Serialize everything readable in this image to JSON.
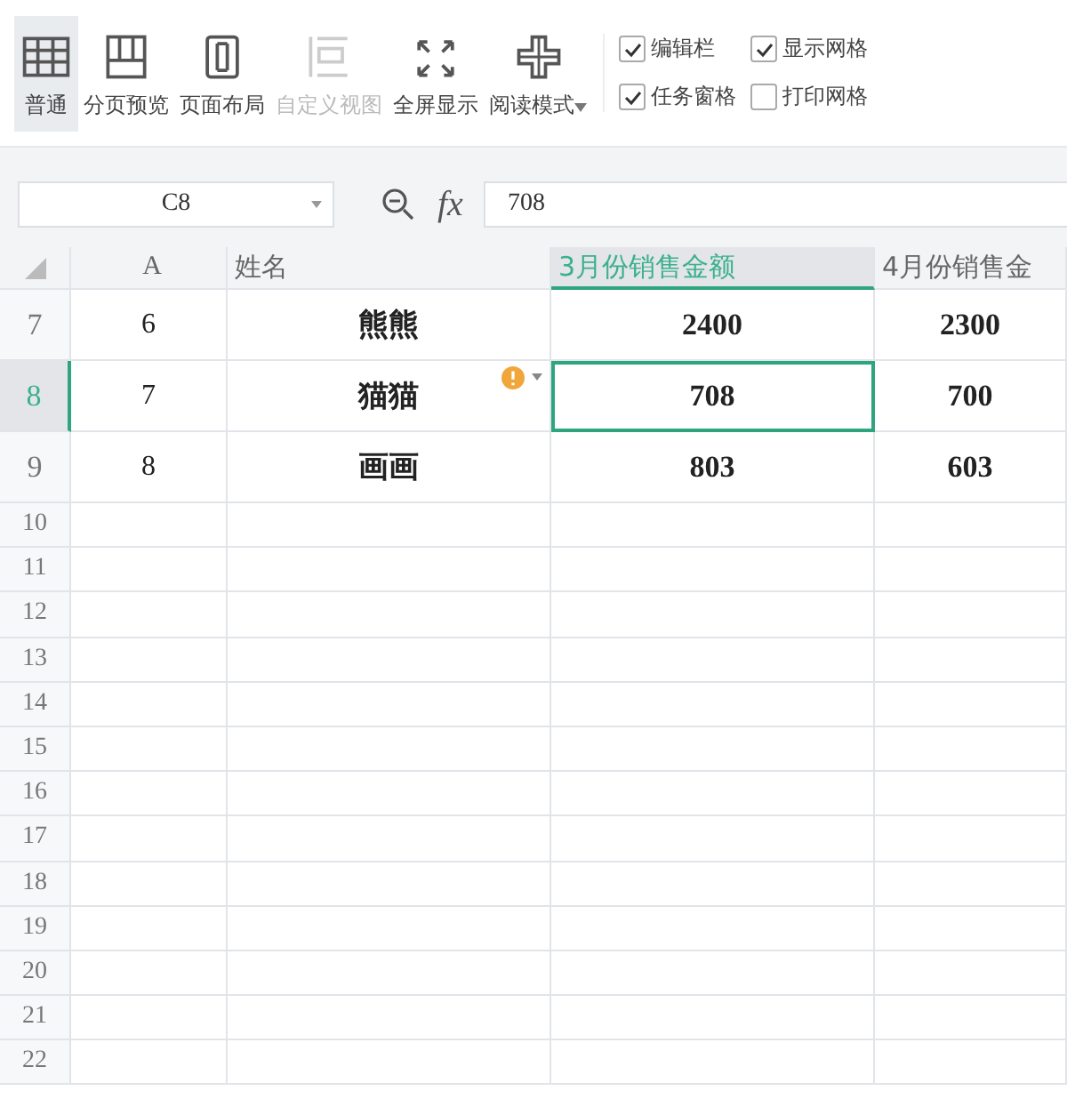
{
  "toolbar": {
    "view_buttons": [
      {
        "kind": "normal",
        "label": "普通",
        "selected": true,
        "disabled": false
      },
      {
        "kind": "page-break",
        "label": "分页预览",
        "selected": false,
        "disabled": false
      },
      {
        "kind": "page-layout",
        "label": "页面布局",
        "selected": false,
        "disabled": false
      },
      {
        "kind": "custom-view",
        "label": "自定义视图",
        "selected": false,
        "disabled": true
      },
      {
        "kind": "fullscreen",
        "label": "全屏显示",
        "selected": false,
        "disabled": false
      },
      {
        "kind": "reading",
        "label": "阅读模式",
        "selected": false,
        "disabled": false,
        "dropdown": true
      }
    ],
    "checkboxes": [
      {
        "label": "编辑栏",
        "checked": true
      },
      {
        "label": "显示网格",
        "checked": true
      },
      {
        "label": "任务窗格",
        "checked": true
      },
      {
        "label": "打印网格",
        "checked": false
      }
    ]
  },
  "formula_bar": {
    "name_box": "C8",
    "fx_label": "fx",
    "value": "708"
  },
  "sheet": {
    "columns": [
      {
        "label": "A",
        "selected": false
      },
      {
        "label": "姓名",
        "selected": false
      },
      {
        "label": "3月份销售金额",
        "selected": true
      },
      {
        "label": "4月份销售金",
        "selected": false
      }
    ],
    "rows": [
      {
        "number": "7",
        "selected": false,
        "cells": [
          {
            "text": "6",
            "selected": false
          },
          {
            "text": "熊熊",
            "selected": false
          },
          {
            "text": "2400",
            "selected": false
          },
          {
            "text": "2300",
            "selected": false
          }
        ]
      },
      {
        "number": "8",
        "selected": true,
        "cells": [
          {
            "text": "7",
            "selected": false
          },
          {
            "text": "猫猫",
            "selected": false,
            "warning": true
          },
          {
            "text": "708",
            "selected": true
          },
          {
            "text": "700",
            "selected": false
          }
        ]
      },
      {
        "number": "9",
        "selected": false,
        "cells": [
          {
            "text": "8",
            "selected": false
          },
          {
            "text": "画画",
            "selected": false
          },
          {
            "text": "803",
            "selected": false
          },
          {
            "text": "603",
            "selected": false
          }
        ]
      },
      {
        "number": "10",
        "selected": false,
        "cells": []
      },
      {
        "number": "11",
        "selected": false,
        "cells": []
      },
      {
        "number": "12",
        "selected": false,
        "cells": []
      },
      {
        "number": "13",
        "selected": false,
        "cells": []
      },
      {
        "number": "14",
        "selected": false,
        "cells": []
      },
      {
        "number": "15",
        "selected": false,
        "cells": []
      },
      {
        "number": "16",
        "selected": false,
        "cells": []
      },
      {
        "number": "17",
        "selected": false,
        "cells": []
      },
      {
        "number": "18",
        "selected": false,
        "cells": []
      },
      {
        "number": "19",
        "selected": false,
        "cells": []
      },
      {
        "number": "20",
        "selected": false,
        "cells": []
      },
      {
        "number": "21",
        "selected": false,
        "cells": []
      },
      {
        "number": "22",
        "selected": false,
        "cells": []
      }
    ]
  }
}
